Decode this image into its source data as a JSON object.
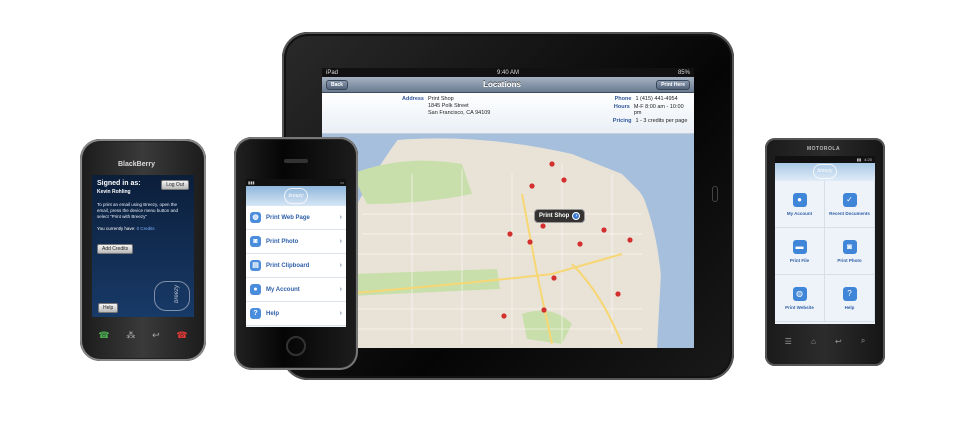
{
  "ipad": {
    "status": {
      "device": "iPad",
      "time": "9:40 AM",
      "battery": "85%"
    },
    "nav": {
      "title": "Locations",
      "back": "Back",
      "action": "Print Here"
    },
    "info": {
      "address_label": "Address",
      "address_lines": [
        "Print Shop",
        "1845 Polk Street",
        "San Francisco, CA 94109"
      ],
      "phone_label": "Phone",
      "phone": "1 (415) 441-4954",
      "hours_label": "Hours",
      "hours": "M-F  8:00 am - 10:00 pm",
      "pricing_label": "Pricing",
      "pricing": "1 - 3 credits per page"
    },
    "map_callout": "Print Shop",
    "map_colors": {
      "land": "#e8e3d6",
      "water": "#a5bfdd",
      "park": "#c9dfab",
      "road": "#f7d774",
      "pin": "#d32f2f"
    }
  },
  "iphone": {
    "brand": "breezy",
    "items": [
      {
        "label": "Print Web Page",
        "icon": "globe-icon",
        "glyph": "◍"
      },
      {
        "label": "Print Photo",
        "icon": "camera-icon",
        "glyph": "◙"
      },
      {
        "label": "Print Clipboard",
        "icon": "clipboard-icon",
        "glyph": "▤"
      },
      {
        "label": "My Account",
        "icon": "user-icon",
        "glyph": "●"
      },
      {
        "label": "Help",
        "icon": "help-icon",
        "glyph": "?"
      }
    ]
  },
  "blackberry": {
    "logo": "BlackBerry",
    "signed_in_as": "Signed in as:",
    "user": "Kevin Rohling",
    "logout": "Log Out",
    "message": "To print an email using Breezy, open the email, press the device menu button and select \"Print with Breezy\"",
    "credits_prefix": "You currently have:",
    "credits_value": "0",
    "credits_suffix": "Credits",
    "add_credits": "Add Credits",
    "help": "Help",
    "brand": "breezy"
  },
  "android": {
    "brand": "MOTOROLA",
    "time": "4:20",
    "items": [
      {
        "label": "My Account",
        "icon": "user-icon",
        "glyph": "●"
      },
      {
        "label": "Recent Documents",
        "icon": "document-check-icon",
        "glyph": "✓"
      },
      {
        "label": "Print File",
        "icon": "folder-icon",
        "glyph": "▬"
      },
      {
        "label": "Print Photo",
        "icon": "camera-icon",
        "glyph": "◙"
      },
      {
        "label": "Print Website",
        "icon": "globe-icon",
        "glyph": "◍"
      },
      {
        "label": "Help",
        "icon": "help-icon",
        "glyph": "?"
      }
    ]
  }
}
